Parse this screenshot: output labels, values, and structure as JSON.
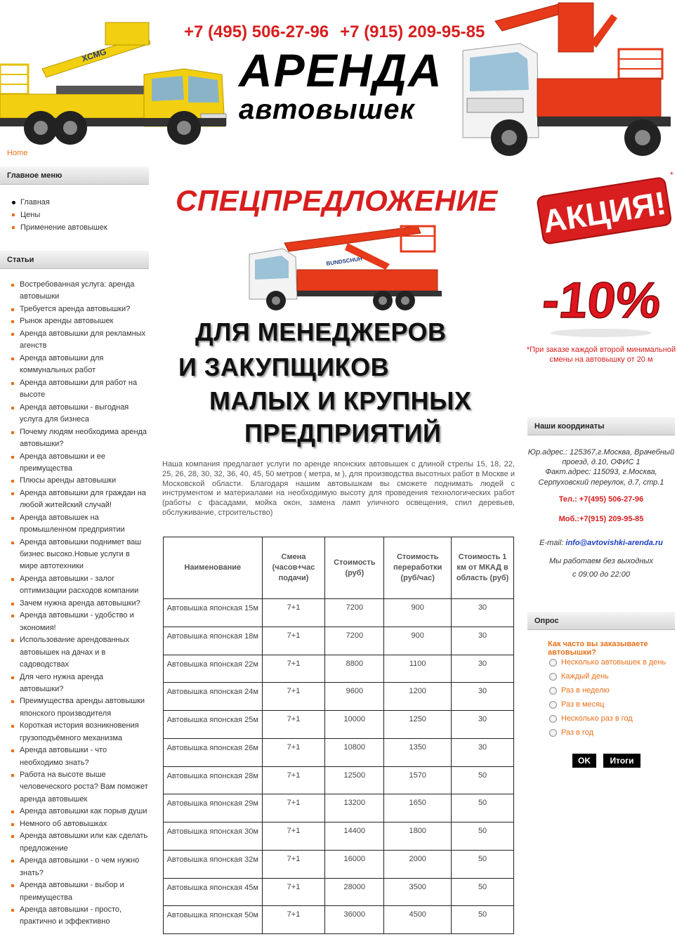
{
  "header": {
    "phone1": "+7 (495) 506-27-96",
    "phone2": "+7 (915) 209-95-85",
    "title_big": "АРЕНДА",
    "title_small": "автовышек",
    "breadcrumb": "Home"
  },
  "main_menu": {
    "title": "Главное меню",
    "items": [
      "Главная",
      "Цены",
      "Применение автовышек"
    ]
  },
  "articles": {
    "title": "Статьи",
    "items": [
      "Востребованная услуга: аренда автовышки",
      "Требуется аренда автовышки?",
      "Рынок аренды автовышек",
      "Аренда автовышки для рекламных агенств",
      "Аренда автовышки для коммунальных работ",
      "Аренда автовышки для работ на высоте",
      "Аренда автовышки - выгодная услуга для бизнеса",
      "Почему людям необходима аренда автовышки?",
      "Аренда автовышки и ее преимущества",
      "Плюсы аренды автовышки",
      "Аренда автовышки для граждан на любой житейский случай!",
      "Аренда автовышек на промышленном предприятии",
      "Аренда автовышки поднимет ваш бизнес высоко.Новые услуги в мире автотехники",
      "Аренда автовышки - залог оптимизации расходов компании",
      "Зачем нужна аренда автовышки?",
      "Аренда автовышки - удобство и экономия!",
      "Использование арендованных автовышек на дачах и в садоводствах",
      "Для чего нужна аренда автовышки?",
      "Преимущества аренды автовышки японского производителя",
      "Короткая история возникновения грузоподъёмного механизма",
      "Аренда автовышки - что необходимо знать?",
      "Работа на высоте выше человеческого роста? Вам поможет аренда автовышек",
      "Аренда автовышки как порыв души",
      "Немного об автовышках",
      "Аренда автовышки или как сделать предложение",
      "Аренда автовышки - о чем нужно знать?",
      "Аренда автовышки - выбор и преимущества",
      "Аренда автовышки - просто, практично и эффективно"
    ]
  },
  "promo": {
    "title": "СПЕЦПРЕДЛОЖЕНИЕ",
    "line1": "ДЛЯ МЕНЕДЖЕРОВ",
    "line2": "И ЗАКУПЩИКОВ",
    "line3": "МАЛЫХ И КРУПНЫХ",
    "line4": "ПРЕДПРИЯТИЙ",
    "truck_brand": "BUNDSCHUH"
  },
  "intro": "Наша компания предлагает услуги по аренде японских автовышек с длиной стрелы 15, 18, 22, 25, 26, 28, 30, 32, 36, 40, 45, 50 метров ( метра, м ), для производства высотных работ в Москве и Московской области. Благодаря нашим автовышкам вы сможете поднимать людей с инструментом и материалами на необходимую высоту для проведения технологических работ (работы с фасадами, мойка окон, замена ламп уличного освещения, спил деревьев, обслуживание, строительство)",
  "price_table": {
    "headers": [
      "Наименование",
      "Смена (часов+час подачи)",
      "Стоимость (руб)",
      "Стоимость переработки (руб/час)",
      "Стоимость 1 км от МКАД в область (руб)"
    ],
    "rows": [
      [
        "Автовышка японская 15м",
        "7+1",
        "7200",
        "900",
        "30"
      ],
      [
        "Автовышка японская 18м",
        "7+1",
        "7200",
        "900",
        "30"
      ],
      [
        "Автовышка японская 22м",
        "7+1",
        "8800",
        "1100",
        "30"
      ],
      [
        "Автовышка японская 24м",
        "7+1",
        "9600",
        "1200",
        "30"
      ],
      [
        "Автовышка японская 25м",
        "7+1",
        "10000",
        "1250",
        "30"
      ],
      [
        "Автовышка японская 26м",
        "7+1",
        "10800",
        "1350",
        "30"
      ],
      [
        "Автовышка японская 28м",
        "7+1",
        "12500",
        "1570",
        "50"
      ],
      [
        "Автовышка японская 29м",
        "7+1",
        "13200",
        "1650",
        "50"
      ],
      [
        "Автовышка японская 30м",
        "7+1",
        "14400",
        "1800",
        "50"
      ],
      [
        "Автовышка японская 32м",
        "7+1",
        "16000",
        "2000",
        "50"
      ],
      [
        "Автовышка японская 45м",
        "7+1",
        "28000",
        "3500",
        "50"
      ],
      [
        "Автовышка японская 50м",
        "7+1",
        "36000",
        "4500",
        "50"
      ]
    ]
  },
  "right": {
    "akcia": "АКЦИЯ!",
    "asterisk": "*",
    "discount": "-10%",
    "note": "*При заказе каждой второй минимальной смены на автовышку от 20 м",
    "coords_title": "Наши координаты",
    "addr1": "Юр.адрес.: 125367,г.Москва, Врачебный проезд, д.10, ОФИС 1",
    "addr2": "Факт.адрес: 115093, г.Москва, Серпуховский переулок, д.7, стр.1",
    "tel": "Тел.: +7(495) 506-27-96",
    "mob": "Моб.:+7(915) 209-95-85",
    "email_label": "E-mail:",
    "email": "info@avtovishki-arenda.ru",
    "hours1": "Мы работаем без выходных",
    "hours2": "с 09:00 до 22:00",
    "poll_title": "Опрос",
    "poll_question": "Как часто вы заказываете автовышки?",
    "poll_options": [
      "Несколько автовышек в день",
      "Каждый день",
      "Раз в неделю",
      "Раз в месяц",
      "Несколько раз в год",
      "Раз в год"
    ],
    "ok": "OK",
    "results": "Итоги"
  },
  "colors": {
    "accent": "#e8701a",
    "red": "#d81e1e",
    "yellow": "#f2cf10"
  },
  "truck_left_brand": "XCMG"
}
